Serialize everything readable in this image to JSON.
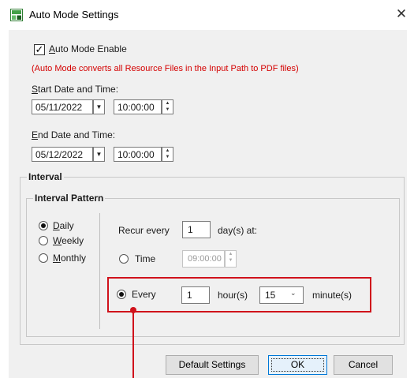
{
  "window": {
    "title": "Auto Mode Settings",
    "close_glyph": "✕"
  },
  "auto_mode": {
    "enable_label": "Auto Mode Enable",
    "checked": true,
    "notice": "(Auto Mode converts all Resource Files in the Input Path to PDF files)"
  },
  "start": {
    "label": "Start Date and Time:",
    "date": "05/11/2022",
    "time": "10:00:00"
  },
  "end": {
    "label": "End Date and Time:",
    "date": "05/12/2022",
    "time": "10:00:00"
  },
  "interval": {
    "title": "Interval",
    "pattern": {
      "title": "Interval Pattern",
      "options": [
        "Daily",
        "Weekly",
        "Monthly"
      ],
      "selected": "Daily"
    },
    "recur": {
      "label": "Recur every",
      "value": "1",
      "unit": "day(s) at:"
    },
    "time_option": {
      "label": "Time",
      "value": "09:00:00",
      "selected": false
    },
    "every_option": {
      "label": "Every",
      "hours": "1",
      "hours_unit": "hour(s)",
      "minutes": "15",
      "minutes_unit": "minute(s)",
      "selected": true
    }
  },
  "buttons": {
    "default_settings": "Default Settings",
    "ok": "OK",
    "cancel": "Cancel"
  },
  "colors": {
    "highlight": "#d0121b",
    "notice": "#d40000",
    "dialog_bg": "#f0f0f0"
  }
}
